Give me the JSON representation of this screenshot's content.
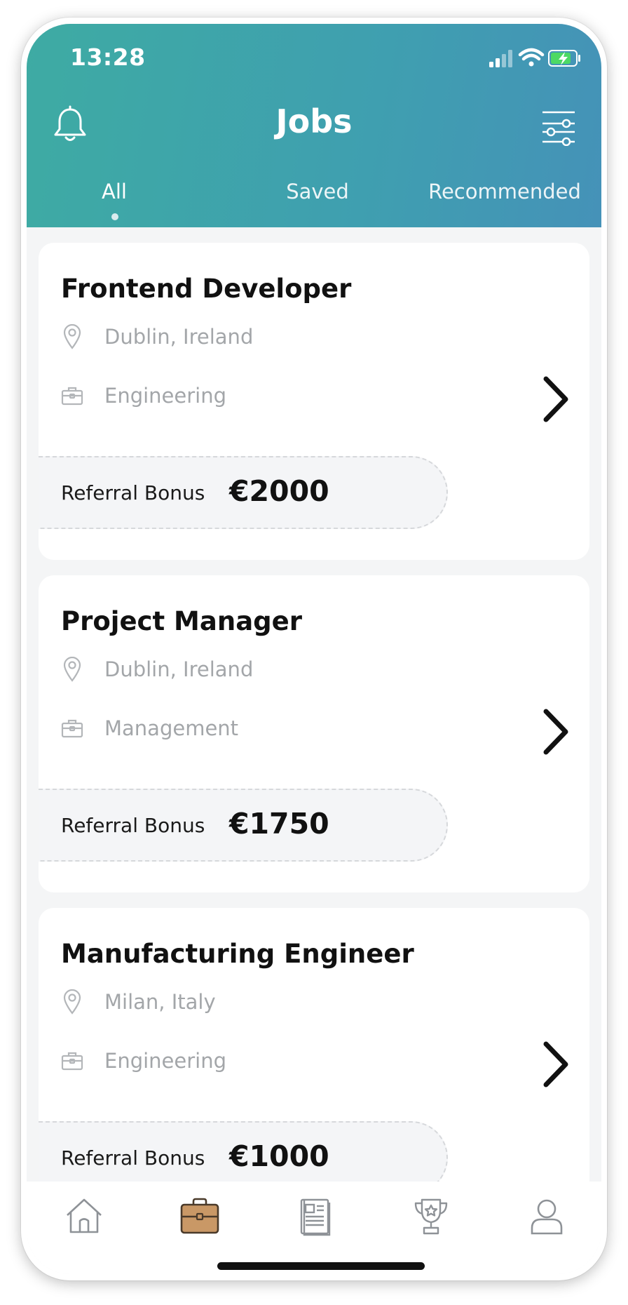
{
  "status_bar": {
    "time": "13:28"
  },
  "header": {
    "title": "Jobs",
    "tabs": [
      {
        "label": "All",
        "active": true
      },
      {
        "label": "Saved",
        "active": false
      },
      {
        "label": "Recommended",
        "active": false
      }
    ]
  },
  "jobs": [
    {
      "title": "Frontend Developer",
      "location": "Dublin, Ireland",
      "department": "Engineering",
      "bonus_label": "Referral Bonus",
      "bonus_amount": "€2000"
    },
    {
      "title": "Project Manager",
      "location": "Dublin, Ireland",
      "department": "Management",
      "bonus_label": "Referral Bonus",
      "bonus_amount": "€1750"
    },
    {
      "title": "Manufacturing Engineer",
      "location": "Milan, Italy",
      "department": "Engineering",
      "bonus_label": "Referral Bonus",
      "bonus_amount": "€1000"
    }
  ],
  "tab_bar": {
    "items": [
      {
        "icon": "home-icon",
        "active": false
      },
      {
        "icon": "briefcase-icon",
        "active": true
      },
      {
        "icon": "newspaper-icon",
        "active": false
      },
      {
        "icon": "trophy-icon",
        "active": false
      },
      {
        "icon": "profile-icon",
        "active": false
      }
    ]
  },
  "colors": {
    "header_gradient_start": "#3eaba3",
    "header_gradient_end": "#4592b8",
    "active_tab_icon": "#b98a5a",
    "muted_text": "#a3a6a9"
  }
}
